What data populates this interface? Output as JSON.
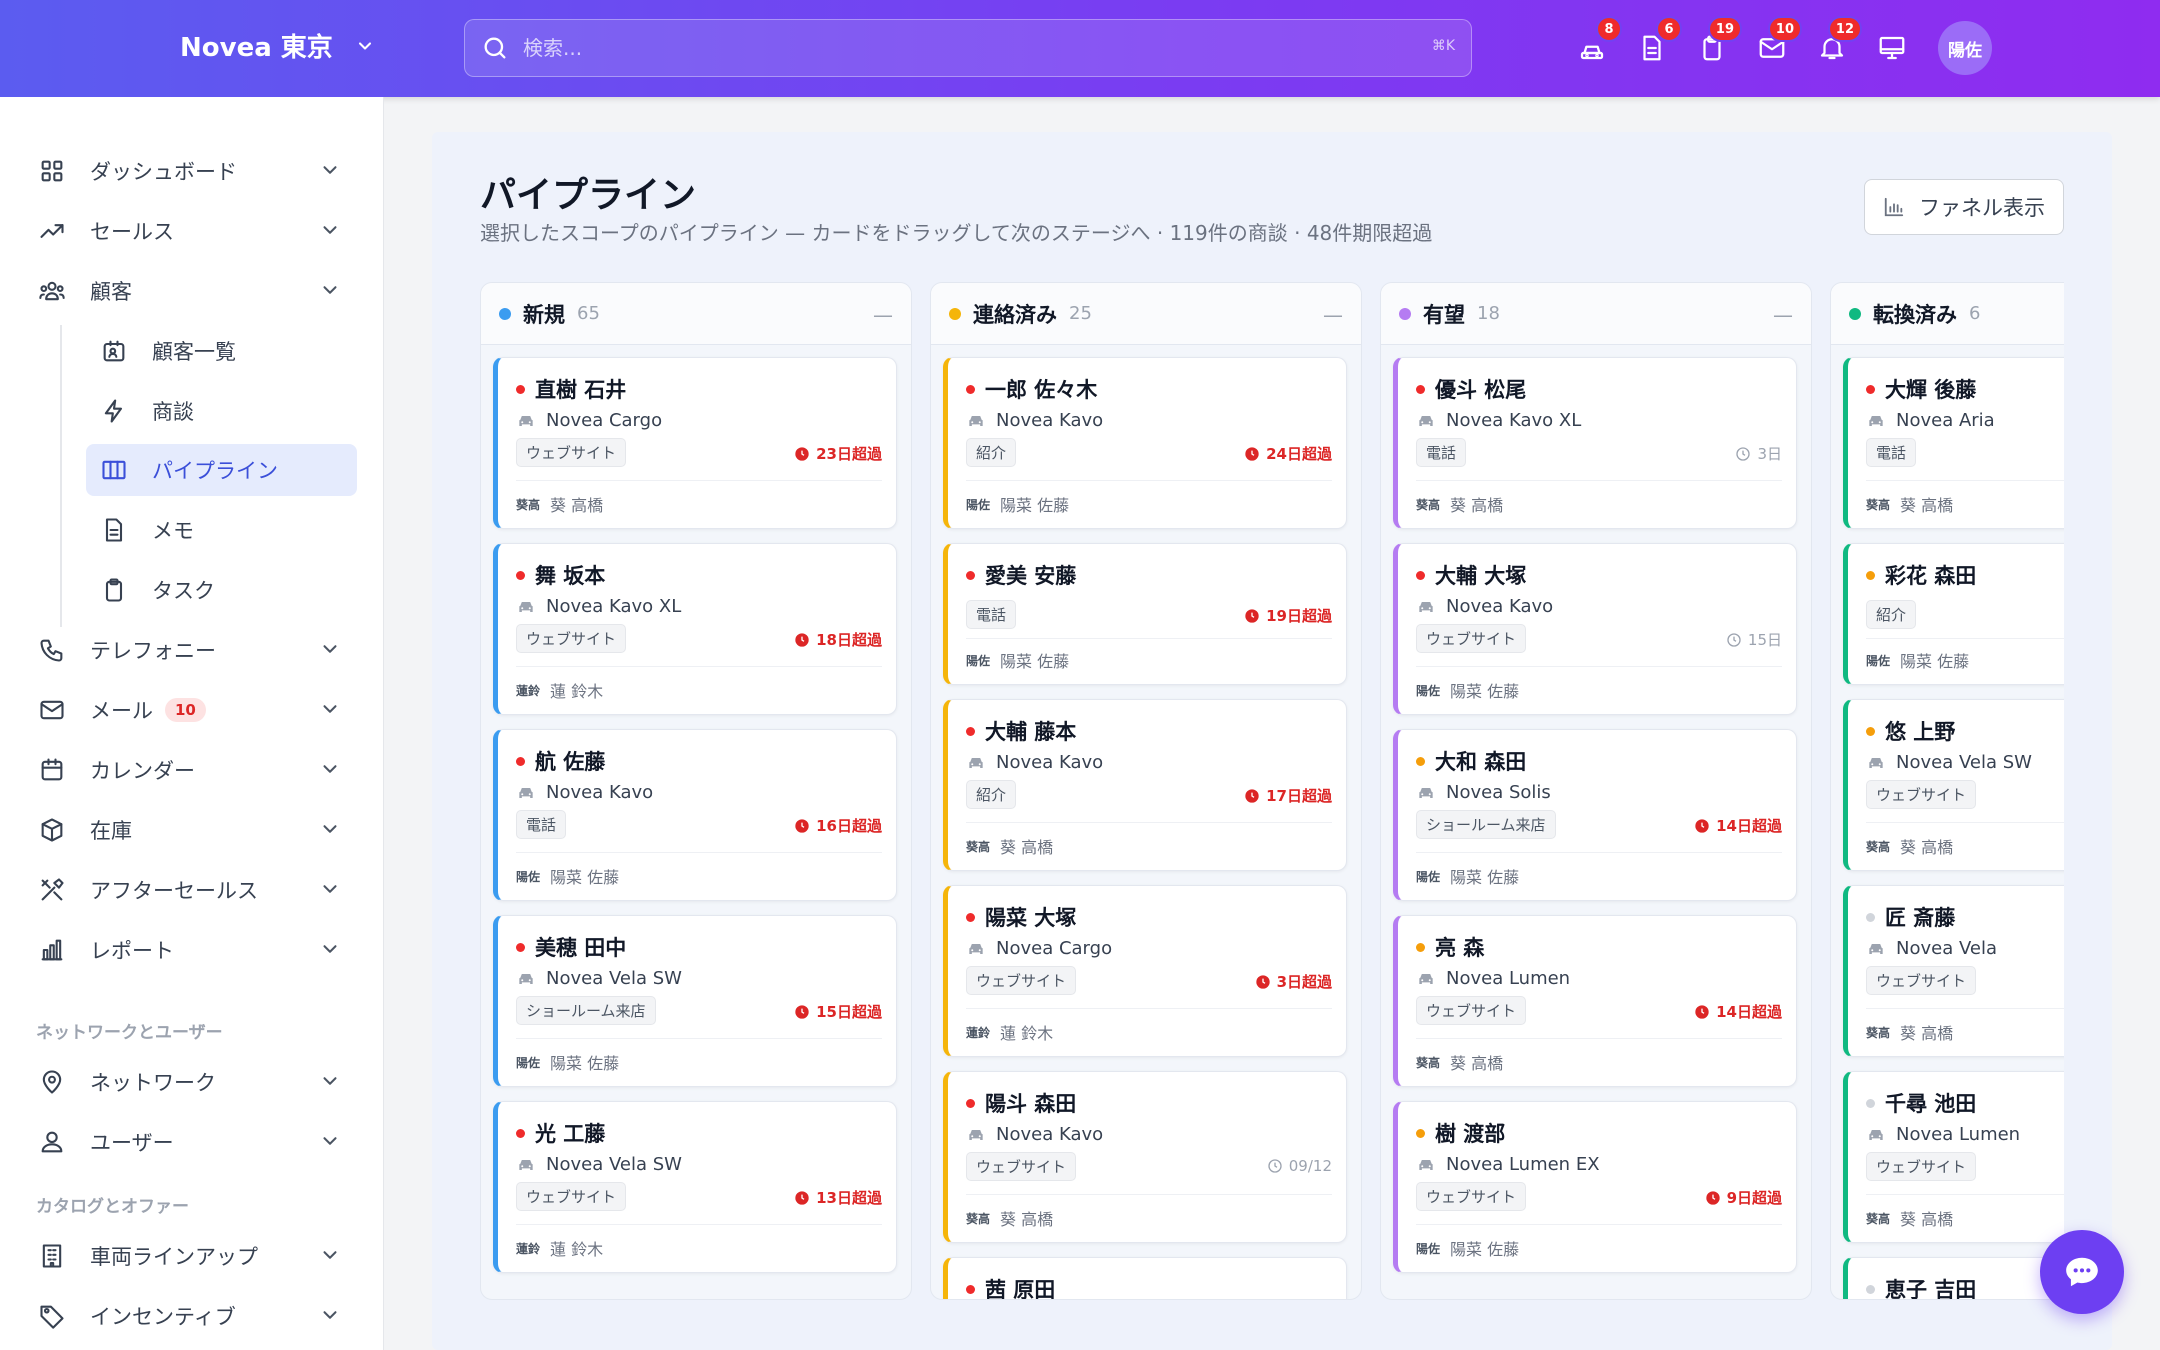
{
  "header": {
    "brand": "Novea 東京",
    "search_placeholder": "検索...",
    "search_shortcut": "⌘K",
    "icons": [
      {
        "name": "car-icon",
        "badge": "8"
      },
      {
        "name": "document-icon",
        "badge": "6"
      },
      {
        "name": "clipboard-icon",
        "badge": "19"
      },
      {
        "name": "mail-icon",
        "badge": "10"
      },
      {
        "name": "bell-icon",
        "badge": "12"
      },
      {
        "name": "monitor-icon",
        "badge": ""
      }
    ],
    "avatar": "陽佐"
  },
  "sidebar": {
    "items": [
      {
        "label": "ダッシュボード",
        "icon": "grid-icon"
      },
      {
        "label": "セールス",
        "icon": "trend-icon"
      },
      {
        "label": "顧客",
        "icon": "users-icon"
      }
    ],
    "sub_items": [
      {
        "label": "顧客一覧",
        "icon": "contact-icon"
      },
      {
        "label": "商談",
        "icon": "bolt-icon"
      },
      {
        "label": "パイプライン",
        "icon": "columns-icon"
      },
      {
        "label": "メモ",
        "icon": "memo-icon"
      },
      {
        "label": "タスク",
        "icon": "clipboard-icon"
      }
    ],
    "items2": [
      {
        "label": "テレフォニー",
        "icon": "phone-icon"
      },
      {
        "label": "メール",
        "icon": "mail-icon",
        "badge": "10"
      },
      {
        "label": "カレンダー",
        "icon": "calendar-icon"
      },
      {
        "label": "在庫",
        "icon": "box-icon"
      },
      {
        "label": "アフターセールス",
        "icon": "tools-icon"
      },
      {
        "label": "レポート",
        "icon": "bars-icon"
      }
    ],
    "section1": "ネットワークとユーザー",
    "items3": [
      {
        "label": "ネットワーク",
        "icon": "pin-icon"
      },
      {
        "label": "ユーザー",
        "icon": "user-icon"
      }
    ],
    "section2": "カタログとオファー",
    "items4": [
      {
        "label": "車両ラインアップ",
        "icon": "building-icon"
      },
      {
        "label": "インセンティブ",
        "icon": "tag-icon"
      }
    ]
  },
  "page": {
    "title": "パイプライン",
    "subtitle": "選択したスコープのパイプライン — カードをドラッグして次のステージへ · 119件の商談 · 48件期限超過",
    "funnel_button": "ファネル表示"
  },
  "columns": [
    {
      "title": "新規",
      "count": "65",
      "color": "#3b9cf0",
      "cards": [
        {
          "name": "直樹 石井",
          "model": "Novea Cargo",
          "tag": "ウェブサイト",
          "due": "23日超過",
          "overdue": true,
          "owner_ini": "葵高",
          "owner": "葵 高橋",
          "prio": "#ef2b2b"
        },
        {
          "name": "舞 坂本",
          "model": "Novea Kavo XL",
          "tag": "ウェブサイト",
          "due": "18日超過",
          "overdue": true,
          "owner_ini": "蓮鈴",
          "owner": "蓮 鈴木",
          "prio": "#ef2b2b"
        },
        {
          "name": "航 佐藤",
          "model": "Novea Kavo",
          "tag": "電話",
          "due": "16日超過",
          "overdue": true,
          "owner_ini": "陽佐",
          "owner": "陽菜 佐藤",
          "prio": "#ef2b2b"
        },
        {
          "name": "美穂 田中",
          "model": "Novea Vela SW",
          "tag": "ショールーム来店",
          "due": "15日超過",
          "overdue": true,
          "owner_ini": "陽佐",
          "owner": "陽菜 佐藤",
          "prio": "#ef2b2b"
        },
        {
          "name": "光 工藤",
          "model": "Novea Vela SW",
          "tag": "ウェブサイト",
          "due": "13日超過",
          "overdue": true,
          "owner_ini": "蓮鈴",
          "owner": "蓮 鈴木",
          "prio": "#ef2b2b"
        }
      ]
    },
    {
      "title": "連絡済み",
      "count": "25",
      "color": "#f5b50a",
      "cards": [
        {
          "name": "一郎 佐々木",
          "model": "Novea Kavo",
          "tag": "紹介",
          "due": "24日超過",
          "overdue": true,
          "owner_ini": "陽佐",
          "owner": "陽菜 佐藤",
          "prio": "#ef2b2b"
        },
        {
          "name": "愛美 安藤",
          "model": "",
          "tag": "電話",
          "due": "19日超過",
          "overdue": true,
          "owner_ini": "陽佐",
          "owner": "陽菜 佐藤",
          "prio": "#ef2b2b"
        },
        {
          "name": "大輔 藤本",
          "model": "Novea Kavo",
          "tag": "紹介",
          "due": "17日超過",
          "overdue": true,
          "owner_ini": "葵高",
          "owner": "葵 高橋",
          "prio": "#ef2b2b"
        },
        {
          "name": "陽菜 大塚",
          "model": "Novea Cargo",
          "tag": "ウェブサイト",
          "due": "3日超過",
          "overdue": true,
          "owner_ini": "蓮鈴",
          "owner": "蓮 鈴木",
          "prio": "#ef2b2b"
        },
        {
          "name": "陽斗 森田",
          "model": "Novea Kavo",
          "tag": "ウェブサイト",
          "due": "09/12",
          "overdue": false,
          "owner_ini": "葵高",
          "owner": "葵 高橋",
          "prio": "#ef2b2b"
        },
        {
          "name": "茜 原田",
          "model": "",
          "tag": "",
          "due": "",
          "overdue": false,
          "owner_ini": "",
          "owner": "",
          "prio": "#ef2b2b"
        }
      ]
    },
    {
      "title": "有望",
      "count": "18",
      "color": "#b57cf2",
      "cards": [
        {
          "name": "優斗 松尾",
          "model": "Novea Kavo XL",
          "tag": "電話",
          "due": "3日",
          "overdue": false,
          "owner_ini": "葵高",
          "owner": "葵 高橋",
          "prio": "#ef2b2b"
        },
        {
          "name": "大輔 大塚",
          "model": "Novea Kavo",
          "tag": "ウェブサイト",
          "due": "15日",
          "overdue": false,
          "owner_ini": "陽佐",
          "owner": "陽菜 佐藤",
          "prio": "#ef2b2b"
        },
        {
          "name": "大和 森田",
          "model": "Novea Solis",
          "tag": "ショールーム来店",
          "due": "14日超過",
          "overdue": true,
          "owner_ini": "陽佐",
          "owner": "陽菜 佐藤",
          "prio": "#f59e0b"
        },
        {
          "name": "亮 森",
          "model": "Novea Lumen",
          "tag": "ウェブサイト",
          "due": "14日超過",
          "overdue": true,
          "owner_ini": "葵高",
          "owner": "葵 高橋",
          "prio": "#f59e0b"
        },
        {
          "name": "樹 渡部",
          "model": "Novea Lumen EX",
          "tag": "ウェブサイト",
          "due": "9日超過",
          "overdue": true,
          "owner_ini": "陽佐",
          "owner": "陽菜 佐藤",
          "prio": "#f59e0b"
        }
      ]
    },
    {
      "title": "転換済み",
      "count": "6",
      "color": "#10b981",
      "cards": [
        {
          "name": "大輝 後藤",
          "model": "Novea Aria",
          "tag": "電話",
          "due": "",
          "overdue": false,
          "owner_ini": "葵高",
          "owner": "葵 高橋",
          "prio": "#ef2b2b"
        },
        {
          "name": "彩花 森田",
          "model": "",
          "tag": "紹介",
          "due": "",
          "overdue": false,
          "owner_ini": "陽佐",
          "owner": "陽菜 佐藤",
          "prio": "#f59e0b"
        },
        {
          "name": "悠 上野",
          "model": "Novea Vela SW",
          "tag": "ウェブサイト",
          "due": "",
          "overdue": false,
          "owner_ini": "葵高",
          "owner": "葵 高橋",
          "prio": "#f59e0b"
        },
        {
          "name": "匠 斎藤",
          "model": "Novea Vela",
          "tag": "ウェブサイト",
          "due": "",
          "overdue": false,
          "owner_ini": "葵高",
          "owner": "葵 高橋",
          "prio": "#d1d5db"
        },
        {
          "name": "千尋 池田",
          "model": "Novea Lumen",
          "tag": "ウェブサイト",
          "due": "",
          "overdue": false,
          "owner_ini": "葵高",
          "owner": "葵 高橋",
          "prio": "#d1d5db"
        },
        {
          "name": "恵子 吉田",
          "model": "",
          "tag": "",
          "due": "",
          "overdue": false,
          "owner_ini": "",
          "owner": "",
          "prio": "#d1d5db"
        }
      ]
    }
  ]
}
